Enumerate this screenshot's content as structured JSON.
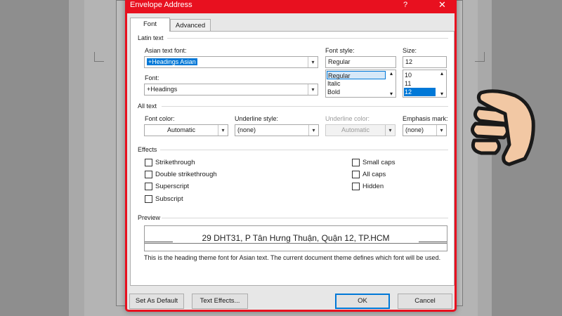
{
  "window": {
    "title": "Envelope Address",
    "help_glyph": "?",
    "close_glyph": "✕"
  },
  "tabs": [
    {
      "label": "Font",
      "active": true
    },
    {
      "label": "Advanced",
      "active": false
    }
  ],
  "latin_text": {
    "section_label": "Latin text",
    "asian_font_label": "Asian text font:",
    "asian_font_value": "+Headings Asian",
    "font_label": "Font:",
    "font_value": "+Headings",
    "font_style_label": "Font style:",
    "font_style_value": "Regular",
    "font_style_options": [
      "Regular",
      "Italic",
      "Bold"
    ],
    "size_label": "Size:",
    "size_value": "12",
    "size_options": [
      "10",
      "11",
      "12"
    ]
  },
  "all_text": {
    "section_label": "All text",
    "font_color_label": "Font color:",
    "font_color_value": "Automatic",
    "underline_style_label": "Underline style:",
    "underline_style_value": "(none)",
    "underline_color_label": "Underline color:",
    "underline_color_value": "Automatic",
    "emphasis_label": "Emphasis mark:",
    "emphasis_value": "(none)"
  },
  "effects": {
    "section_label": "Effects",
    "left": [
      "Strikethrough",
      "Double strikethrough",
      "Superscript",
      "Subscript"
    ],
    "right": [
      "Small caps",
      "All caps",
      "Hidden"
    ]
  },
  "preview": {
    "section_label": "Preview",
    "sample_text": "29 DHT31, P Tân Hưng Thuận, Quận 12, TP.HCM",
    "note": "This is the heading theme font for Asian text. The current document theme defines which font will be used."
  },
  "buttons": {
    "set_default": "Set As Default",
    "text_effects": "Text Effects...",
    "ok": "OK",
    "cancel": "Cancel"
  },
  "colors": {
    "highlight_border": "#e8101f",
    "selection": "#0078d7",
    "hand_fill": "#f2c8a4",
    "hand_stroke": "#1a1a1a"
  },
  "icons": {
    "dropdown": "▾",
    "scroll_up": "▴",
    "scroll_down": "▾"
  }
}
